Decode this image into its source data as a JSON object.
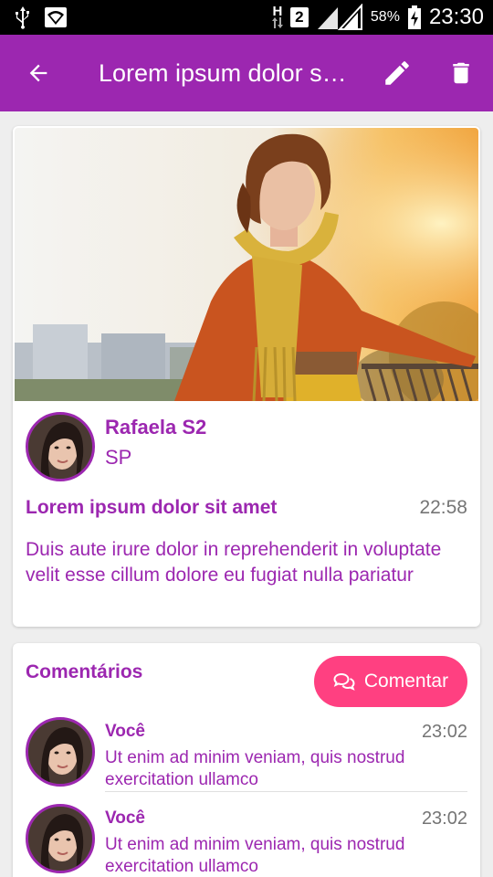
{
  "status_bar": {
    "signal_h": "H",
    "sim_slot": "2",
    "battery": "58%",
    "time": "23:30",
    "icons": [
      "usb-icon",
      "wifi-notification-icon",
      "data-arrows-icon",
      "signal-icon",
      "battery-charging-icon"
    ]
  },
  "app_bar": {
    "title": "Lorem ipsum dolor sit amet",
    "icons": [
      "arrow-back-icon",
      "pencil-edit-icon",
      "trash-icon"
    ]
  },
  "post": {
    "author_name": "Rafaela S2",
    "author_location": "SP",
    "title": "Lorem ipsum dolor sit amet",
    "time": "22:58",
    "body": "Duis aute irure dolor in reprehenderit in voluptate velit esse cillum dolore eu fugiat nulla pariatur"
  },
  "comments_section": {
    "title": "Comentários",
    "button_label": "Comentar",
    "items": [
      {
        "author": "Você",
        "time": "23:02",
        "text": "Ut enim ad minim veniam, quis nostrud exercitation ullamco"
      },
      {
        "author": "Você",
        "time": "23:02",
        "text": "Ut enim ad minim veniam, quis nostrud exercitation ullamco"
      }
    ]
  },
  "colors": {
    "primary": "#9c27b0",
    "accent": "#ff4081",
    "secondary_text": "#757575",
    "background": "#eeeeee"
  }
}
